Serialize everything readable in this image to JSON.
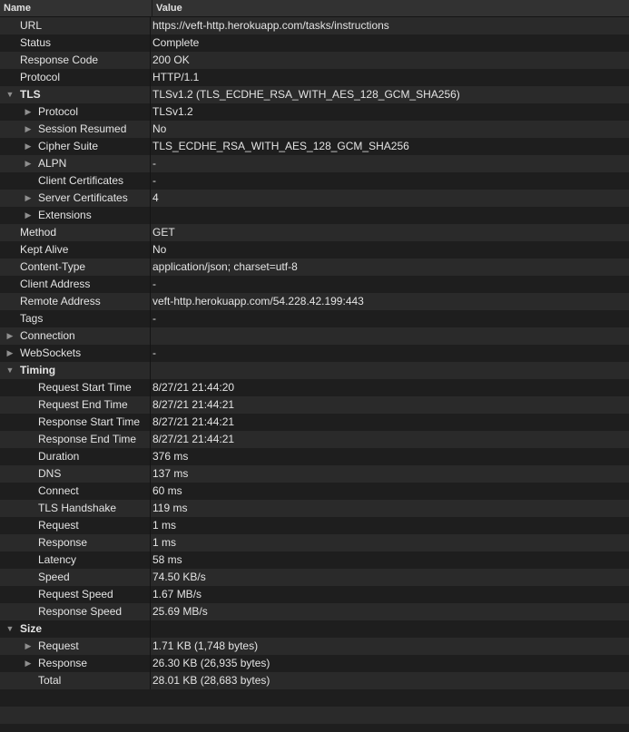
{
  "header": {
    "name": "Name",
    "value": "Value"
  },
  "rows": [
    {
      "level": 0,
      "toggle": "none",
      "bold": false,
      "name": "URL",
      "value": "https://veft-http.herokuapp.com/tasks/instructions"
    },
    {
      "level": 0,
      "toggle": "none",
      "bold": false,
      "name": "Status",
      "value": "Complete"
    },
    {
      "level": 0,
      "toggle": "none",
      "bold": false,
      "name": "Response Code",
      "value": "200 OK"
    },
    {
      "level": 0,
      "toggle": "none",
      "bold": false,
      "name": "Protocol",
      "value": "HTTP/1.1"
    },
    {
      "level": 0,
      "toggle": "expanded",
      "bold": true,
      "name": "TLS",
      "value": "TLSv1.2 (TLS_ECDHE_RSA_WITH_AES_128_GCM_SHA256)"
    },
    {
      "level": 1,
      "toggle": "collapsed",
      "bold": false,
      "name": "Protocol",
      "value": "TLSv1.2"
    },
    {
      "level": 1,
      "toggle": "collapsed",
      "bold": false,
      "name": "Session Resumed",
      "value": "No"
    },
    {
      "level": 1,
      "toggle": "collapsed",
      "bold": false,
      "name": "Cipher Suite",
      "value": "TLS_ECDHE_RSA_WITH_AES_128_GCM_SHA256"
    },
    {
      "level": 1,
      "toggle": "collapsed",
      "bold": false,
      "name": "ALPN",
      "value": "-"
    },
    {
      "level": 1,
      "toggle": "none",
      "bold": false,
      "name": "Client Certificates",
      "value": "-"
    },
    {
      "level": 1,
      "toggle": "collapsed",
      "bold": false,
      "name": "Server Certificates",
      "value": "4"
    },
    {
      "level": 1,
      "toggle": "collapsed",
      "bold": false,
      "name": "Extensions",
      "value": ""
    },
    {
      "level": 0,
      "toggle": "none",
      "bold": false,
      "name": "Method",
      "value": "GET"
    },
    {
      "level": 0,
      "toggle": "none",
      "bold": false,
      "name": "Kept Alive",
      "value": "No"
    },
    {
      "level": 0,
      "toggle": "none",
      "bold": false,
      "name": "Content-Type",
      "value": "application/json; charset=utf-8"
    },
    {
      "level": 0,
      "toggle": "none",
      "bold": false,
      "name": "Client Address",
      "value": "-"
    },
    {
      "level": 0,
      "toggle": "none",
      "bold": false,
      "name": "Remote Address",
      "value": "veft-http.herokuapp.com/54.228.42.199:443"
    },
    {
      "level": 0,
      "toggle": "none",
      "bold": false,
      "name": "Tags",
      "value": "-"
    },
    {
      "level": 0,
      "toggle": "collapsed",
      "bold": false,
      "name": "Connection",
      "value": ""
    },
    {
      "level": 0,
      "toggle": "collapsed",
      "bold": false,
      "name": "WebSockets",
      "value": "-"
    },
    {
      "level": 0,
      "toggle": "expanded",
      "bold": true,
      "name": "Timing",
      "value": ""
    },
    {
      "level": 1,
      "toggle": "none",
      "bold": false,
      "name": "Request Start Time",
      "value": "8/27/21 21:44:20"
    },
    {
      "level": 1,
      "toggle": "none",
      "bold": false,
      "name": "Request End Time",
      "value": "8/27/21 21:44:21"
    },
    {
      "level": 1,
      "toggle": "none",
      "bold": false,
      "name": "Response Start Time",
      "value": "8/27/21 21:44:21"
    },
    {
      "level": 1,
      "toggle": "none",
      "bold": false,
      "name": "Response End Time",
      "value": "8/27/21 21:44:21"
    },
    {
      "level": 1,
      "toggle": "none",
      "bold": false,
      "name": "Duration",
      "value": "376 ms"
    },
    {
      "level": 1,
      "toggle": "none",
      "bold": false,
      "name": "DNS",
      "value": "137 ms"
    },
    {
      "level": 1,
      "toggle": "none",
      "bold": false,
      "name": "Connect",
      "value": "60 ms"
    },
    {
      "level": 1,
      "toggle": "none",
      "bold": false,
      "name": "TLS Handshake",
      "value": "119 ms"
    },
    {
      "level": 1,
      "toggle": "none",
      "bold": false,
      "name": "Request",
      "value": "1 ms"
    },
    {
      "level": 1,
      "toggle": "none",
      "bold": false,
      "name": "Response",
      "value": "1 ms"
    },
    {
      "level": 1,
      "toggle": "none",
      "bold": false,
      "name": "Latency",
      "value": "58 ms"
    },
    {
      "level": 1,
      "toggle": "none",
      "bold": false,
      "name": "Speed",
      "value": "74.50 KB/s"
    },
    {
      "level": 1,
      "toggle": "none",
      "bold": false,
      "name": "Request Speed",
      "value": "1.67 MB/s"
    },
    {
      "level": 1,
      "toggle": "none",
      "bold": false,
      "name": "Response Speed",
      "value": "25.69 MB/s"
    },
    {
      "level": 0,
      "toggle": "expanded",
      "bold": true,
      "name": "Size",
      "value": ""
    },
    {
      "level": 1,
      "toggle": "collapsed",
      "bold": false,
      "name": "Request",
      "value": "1.71 KB (1,748 bytes)"
    },
    {
      "level": 1,
      "toggle": "collapsed",
      "bold": false,
      "name": "Response",
      "value": "26.30 KB (26,935 bytes)"
    },
    {
      "level": 1,
      "toggle": "none",
      "bold": false,
      "name": "Total",
      "value": "28.01 KB (28,683 bytes)"
    }
  ],
  "icons": {
    "expanded": "disclosure-triangle-down-icon",
    "collapsed": "disclosure-triangle-right-icon"
  },
  "glyphs": {
    "expanded": "▼",
    "collapsed": "▶"
  },
  "colors": {
    "background": "#1e1e1e",
    "row_alt": "#2a2a2a",
    "header": "#323232",
    "text": "#e4e4e4",
    "triangle": "#8f8f8f"
  }
}
